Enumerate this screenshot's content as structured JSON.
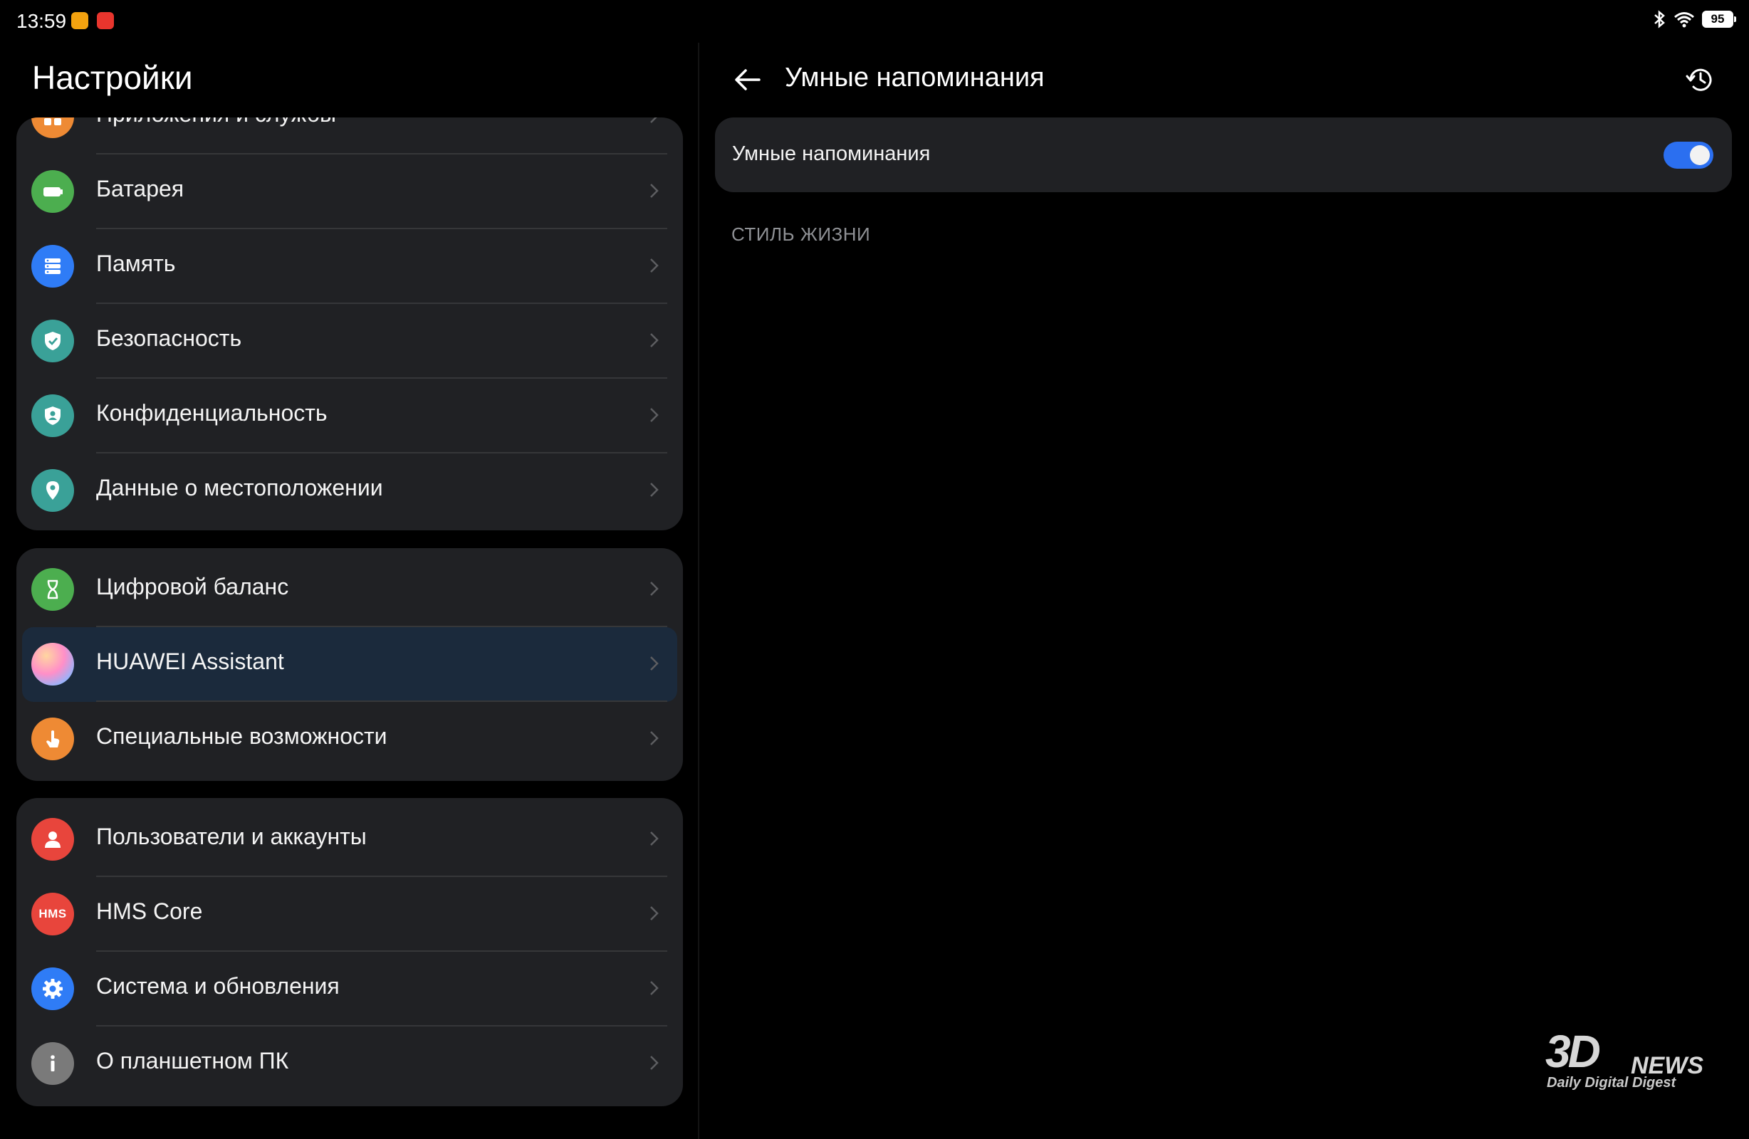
{
  "status_bar": {
    "time": "13:59",
    "battery": "95"
  },
  "settings": {
    "title": "Настройки",
    "groups": [
      {
        "items": [
          {
            "label": "Приложения и службы",
            "icon": "apps-icon",
            "color": "#ee8a34"
          },
          {
            "label": "Батарея",
            "icon": "battery-icon",
            "color": "#4cae4f"
          },
          {
            "label": "Память",
            "icon": "storage-icon",
            "color": "#2f7cf6"
          },
          {
            "label": "Безопасность",
            "icon": "shield-icon",
            "color": "#3aa198"
          },
          {
            "label": "Конфиденциальность",
            "icon": "privacy-icon",
            "color": "#3aa198"
          },
          {
            "label": "Данные о местоположении",
            "icon": "location-pin-icon",
            "color": "#3aa198"
          }
        ]
      },
      {
        "items": [
          {
            "label": "Цифровой баланс",
            "icon": "hourglass-icon",
            "color": "#4cae4f"
          },
          {
            "label": "HUAWEI Assistant",
            "icon": "huawei-assistant-icon",
            "color": "#c8a0ff",
            "selected": true
          },
          {
            "label": "Специальные возможности",
            "icon": "hand-pointer-icon",
            "color": "#ee8a34"
          }
        ]
      },
      {
        "items": [
          {
            "label": "Пользователи и аккаунты",
            "icon": "user-icon",
            "color": "#e8453c"
          },
          {
            "label": "HMS Core",
            "icon": "hms-icon",
            "icon_text": "HMS",
            "color": "#e8453c"
          },
          {
            "label": "Система и обновления",
            "icon": "gear-icon",
            "color": "#2f7cf6"
          },
          {
            "label": "О планшетном ПК",
            "icon": "info-icon",
            "color": "#7a7a7a"
          }
        ]
      }
    ]
  },
  "detail": {
    "title": "Умные напоминания",
    "toggle": {
      "label": "Умные напоминания",
      "on": true,
      "color": "#2b6ff0"
    },
    "section_header": "СТИЛЬ ЖИЗНИ"
  },
  "watermark": {
    "logo": "3D",
    "news": "NEWS",
    "tagline": "Daily Digital Digest"
  }
}
